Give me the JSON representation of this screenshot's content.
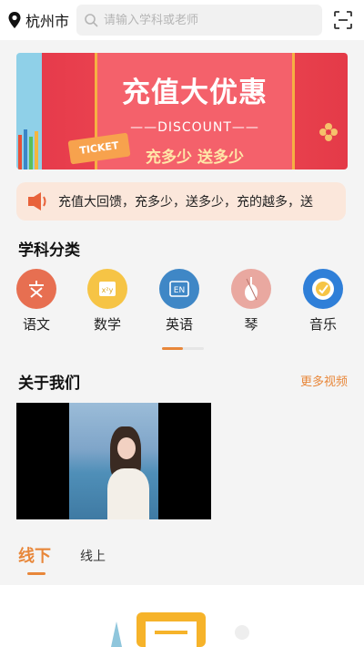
{
  "header": {
    "city": "杭州市",
    "search_placeholder": "请输入学科或老师"
  },
  "banner": {
    "title": "充值大优惠",
    "subtitle": "——DISCOUNT——",
    "slogan": "充多少 送多少",
    "ticket": "TICKET"
  },
  "notice": {
    "text": "充值大回馈，充多少，送多少，充的越多，送"
  },
  "categories_section": {
    "title": "学科分类",
    "items": [
      {
        "label": "语文",
        "color": "#e76f51"
      },
      {
        "label": "数学",
        "color": "#f6c445"
      },
      {
        "label": "英语",
        "color": "#3f87c6"
      },
      {
        "label": "琴",
        "color": "#e9a8a0"
      },
      {
        "label": "音乐",
        "color": "#2f7fd8"
      }
    ],
    "indicator_progress": 0.5
  },
  "about_section": {
    "title": "关于我们",
    "more": "更多视频"
  },
  "tabs": {
    "offline": "线下",
    "online": "线上"
  },
  "colors": {
    "accent": "#e8873a",
    "banner": "#e63b4b"
  }
}
